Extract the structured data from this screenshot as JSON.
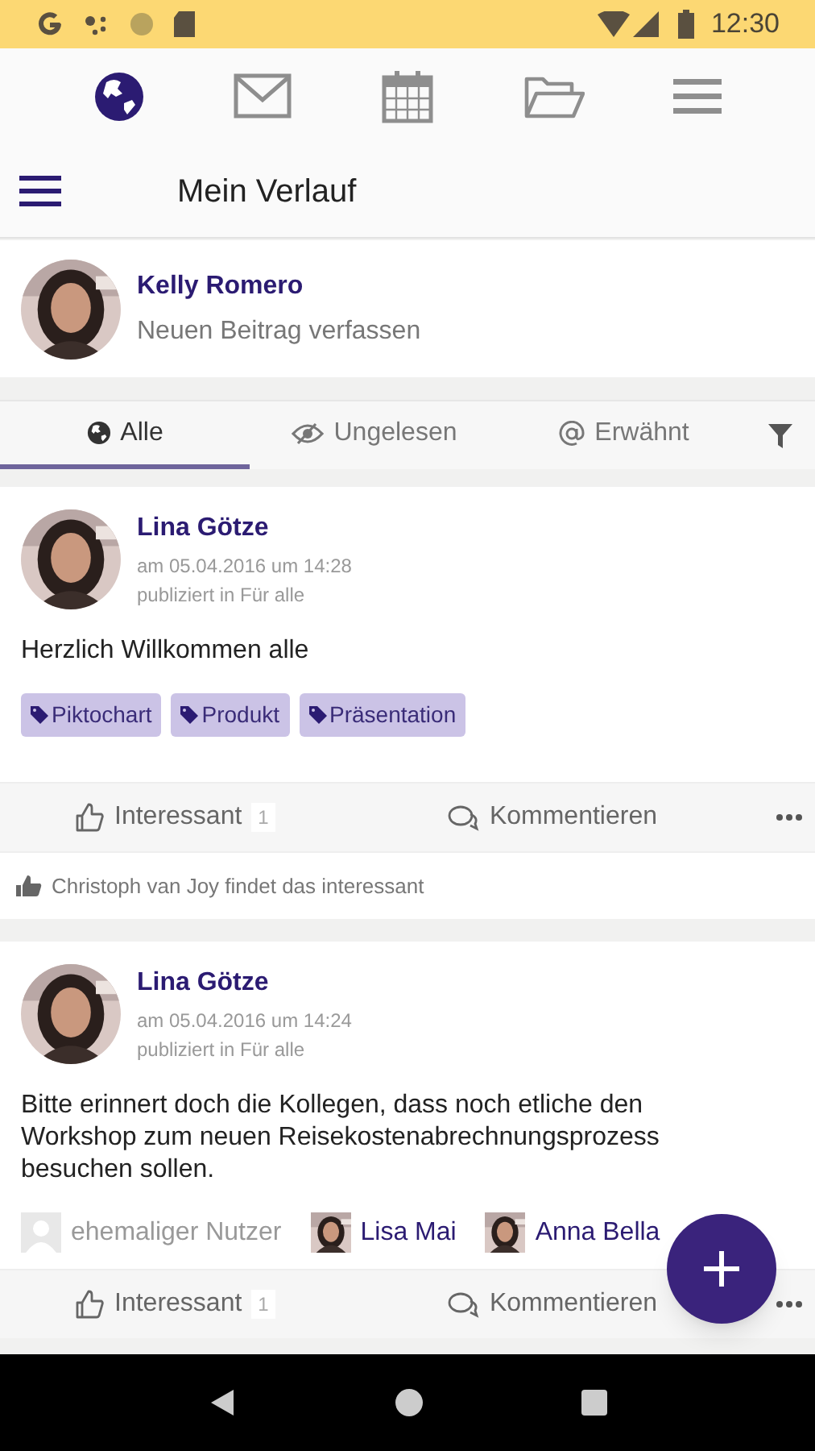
{
  "status_bar": {
    "time": "12:30"
  },
  "top_nav": [
    {
      "kind": "globe",
      "selected": true
    },
    {
      "kind": "mail",
      "selected": false
    },
    {
      "kind": "calendar",
      "selected": false
    },
    {
      "kind": "folder",
      "selected": false
    },
    {
      "kind": "menu",
      "selected": false
    }
  ],
  "header": {
    "title": "Mein Verlauf"
  },
  "composer": {
    "name": "Kelly Romero",
    "prompt": "Neuen Beitrag verfassen"
  },
  "tabs": [
    {
      "kind": "globe",
      "label": "Alle",
      "selected": true
    },
    {
      "kind": "eye",
      "label": "Ungelesen",
      "selected": false
    },
    {
      "kind": "at",
      "label": "Erwähnt",
      "selected": false
    }
  ],
  "posts": [
    {
      "author": "Lina Götze",
      "date": "am 05.04.2016 um 14:28",
      "audience": "publiziert in Für alle",
      "text": "Herzlich Willkommen alle",
      "tags": [
        "Piktochart",
        "Produkt",
        "Präsentation"
      ],
      "like_label": "Interessant",
      "like_count": "1",
      "comment_label": "Kommentieren",
      "likers": "Christoph van Joy findet das interessant"
    },
    {
      "author": "Lina Götze",
      "date": "am 05.04.2016 um 14:24",
      "audience": "publiziert in Für alle",
      "text": "Bitte erinnert doch die Kollegen, dass noch etliche den Workshop zum neuen Reisekostenabrechnungsprozess besuchen sollen.",
      "mentions": [
        {
          "name": "ehemaliger Nutzer",
          "kind": "former"
        },
        {
          "name": "Lisa Mai",
          "kind": "user"
        },
        {
          "name": "Anna Bella",
          "kind": "user"
        }
      ],
      "like_label": "Interessant",
      "like_count": "1",
      "comment_label": "Kommentieren"
    }
  ]
}
